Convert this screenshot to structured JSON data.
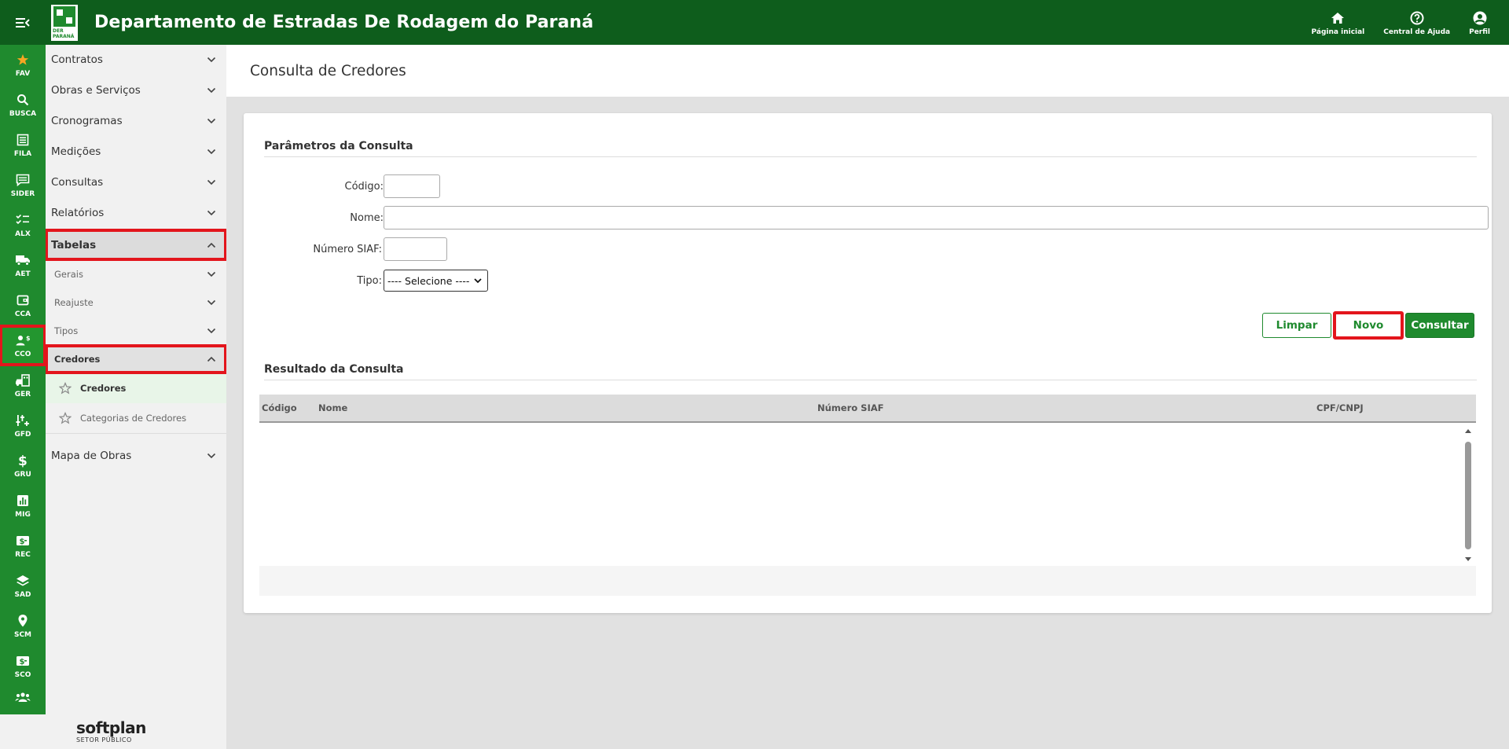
{
  "header": {
    "title": "Departamento de Estradas De Rodagem do Paraná",
    "logo_tag": "DER PARANÁ",
    "actions": [
      {
        "label": "Página inicial",
        "icon": "home-icon"
      },
      {
        "label": "Central de Ajuda",
        "icon": "help-icon"
      },
      {
        "label": "Perfil",
        "icon": "profile-icon"
      }
    ]
  },
  "rail": {
    "items": [
      {
        "label": "FAV",
        "icon": "star-icon"
      },
      {
        "label": "BUSCA",
        "icon": "search-icon"
      },
      {
        "label": "FILA",
        "icon": "list-icon"
      },
      {
        "label": "SIDER",
        "icon": "message-icon"
      },
      {
        "label": "ALX",
        "icon": "checklist-icon"
      },
      {
        "label": "AET",
        "icon": "truck-icon"
      },
      {
        "label": "CCA",
        "icon": "wallet-icon"
      },
      {
        "label": "CCO",
        "icon": "person-dollar-icon",
        "active": true
      },
      {
        "label": "GER",
        "icon": "car-building-icon"
      },
      {
        "label": "GFD",
        "icon": "tools-icon"
      },
      {
        "label": "GRU",
        "icon": "dollar-icon"
      },
      {
        "label": "MIG",
        "icon": "chart-icon"
      },
      {
        "label": "REC",
        "icon": "money-icon"
      },
      {
        "label": "SAD",
        "icon": "layers-icon"
      },
      {
        "label": "SCM",
        "icon": "location-icon"
      },
      {
        "label": "SCO",
        "icon": "money-icon"
      }
    ]
  },
  "sidebar": {
    "items": [
      {
        "label": "Contratos"
      },
      {
        "label": "Obras e Serviços"
      },
      {
        "label": "Cronogramas"
      },
      {
        "label": "Medições"
      },
      {
        "label": "Consultas"
      },
      {
        "label": "Relatórios"
      }
    ],
    "tabelas": {
      "label": "Tabelas",
      "children": [
        {
          "label": "Gerais"
        },
        {
          "label": "Reajuste"
        },
        {
          "label": "Tipos"
        }
      ],
      "credores": {
        "label": "Credores",
        "children": [
          {
            "label": "Credores",
            "active": true
          },
          {
            "label": "Categorias de Credores"
          }
        ]
      }
    },
    "last_item": {
      "label": "Mapa de Obras"
    }
  },
  "brand": {
    "name": "softplan",
    "subtitle": "SETOR PÚBLICO"
  },
  "page": {
    "title": "Consulta de Credores"
  },
  "form": {
    "section_title": "Parâmetros da Consulta",
    "codigo_label": "Código:",
    "codigo_value": "",
    "nome_label": "Nome:",
    "nome_value": "",
    "siaf_label": "Número SIAF:",
    "siaf_value": "",
    "tipo_label": "Tipo:",
    "tipo_selected": "---- Selecione ----",
    "buttons": {
      "limpar": "Limpar",
      "novo": "Novo",
      "consultar": "Consultar"
    }
  },
  "results": {
    "section_title": "Resultado da Consulta",
    "columns": [
      "Código",
      "Nome",
      "Número SIAF",
      "CPF/CNPJ"
    ],
    "rows": []
  },
  "colors": {
    "header_green": "#0e5d1c",
    "rail_green": "#1f8a2e",
    "highlight_red": "#e3151c"
  }
}
